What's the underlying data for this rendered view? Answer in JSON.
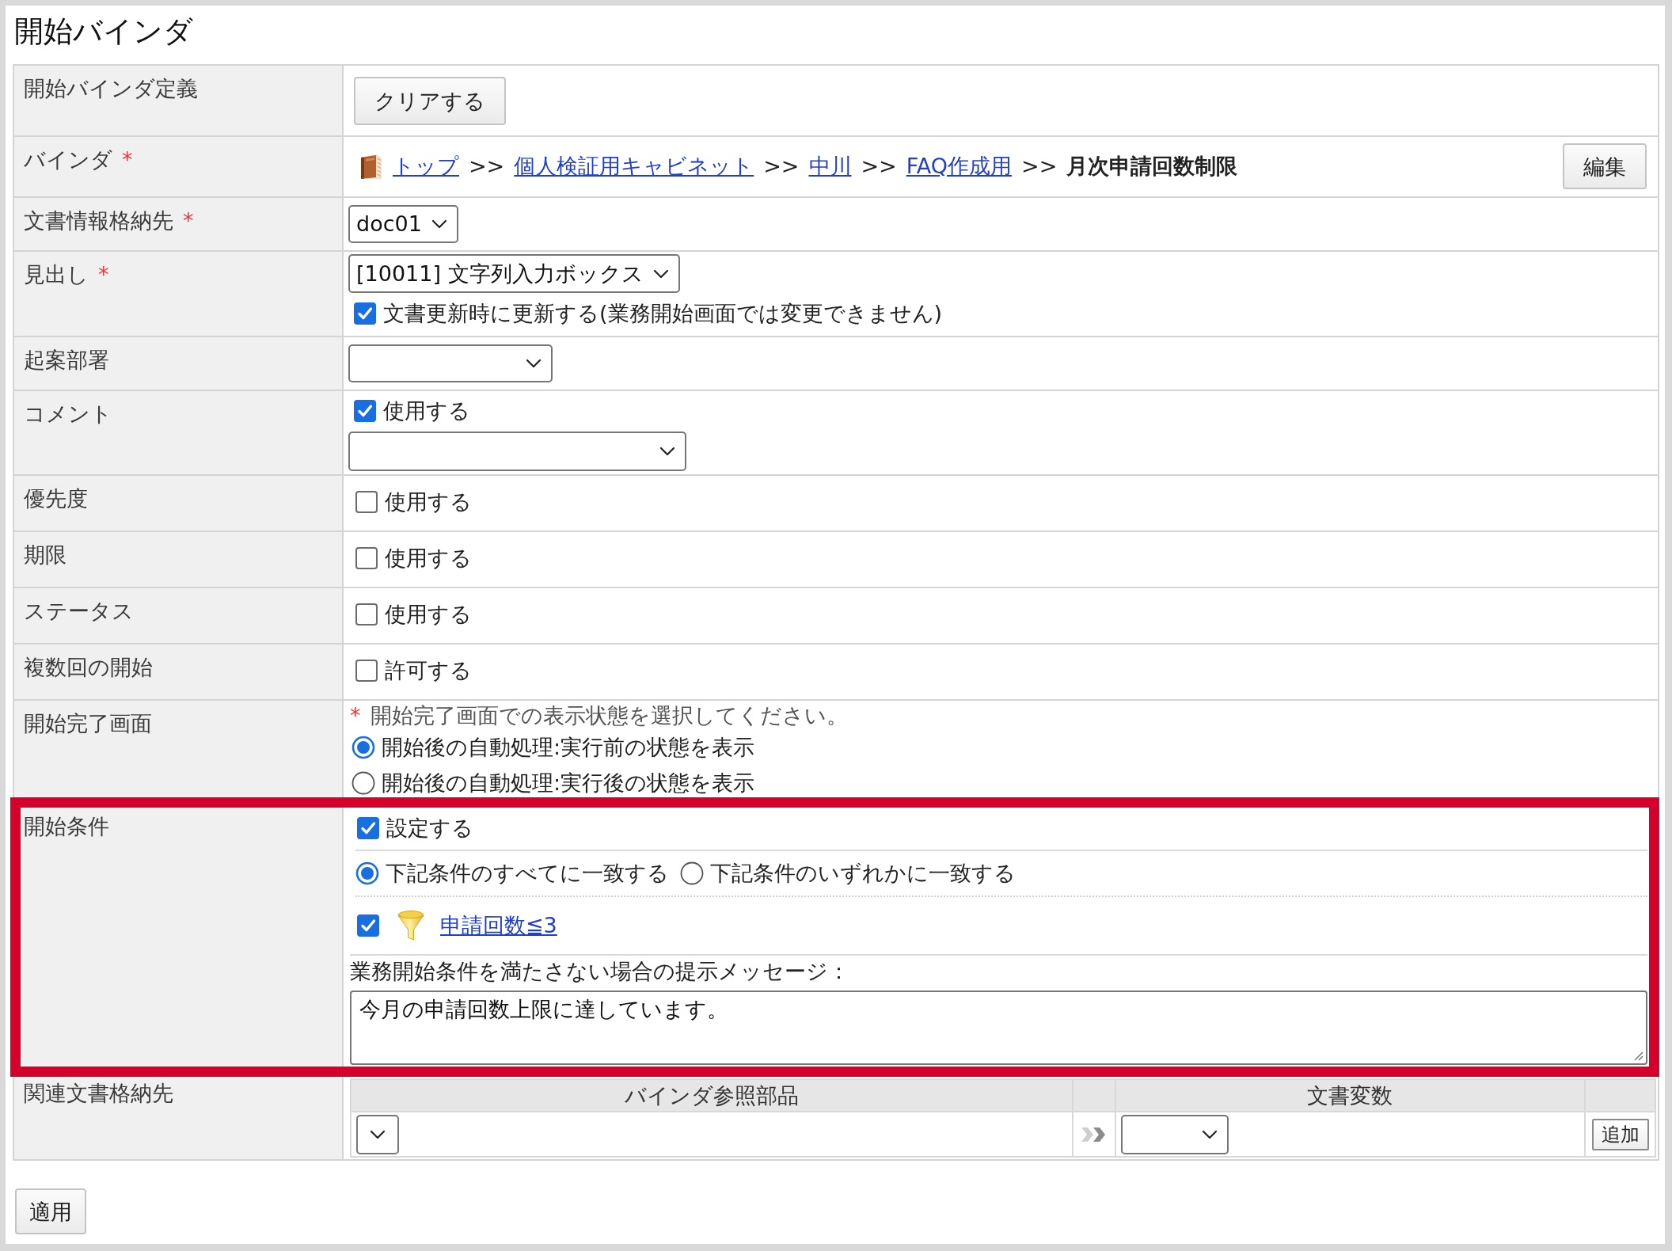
{
  "page": {
    "title": "開始バインダ"
  },
  "rows": [
    {
      "kind": "button",
      "label": "開始バインダ定義",
      "button": "クリアする"
    },
    {
      "kind": "breadcrumb",
      "label": "バインダ",
      "required_mark": "*",
      "path": [
        {
          "text": "トップ",
          "link": true
        },
        {
          "separator": ">>",
          "text": "個人検証用キャビネット",
          "link": true
        },
        {
          "separator": ">>",
          "text": "中川",
          "link": true
        },
        {
          "separator": ">>",
          "text": "FAQ作成用",
          "link": true
        },
        {
          "separator": ">>",
          "text": "月次申請回数制限",
          "link": false
        }
      ],
      "button": "編集"
    },
    {
      "kind": "select",
      "label": "文書情報格納先",
      "required_mark": "*",
      "select": {
        "value": "doc01"
      }
    },
    {
      "kind": "select_check",
      "label": "見出し",
      "required_mark": "*",
      "select": {
        "value": "[10011] 文字列入力ボックス"
      },
      "checkbox": {
        "label": "文書更新時に更新する(業務開始画面では変更できません)",
        "checked": true
      }
    },
    {
      "kind": "select",
      "label": "起案部署"
    },
    {
      "kind": "check_select",
      "label": "コメント",
      "checkbox": {
        "label": "使用する",
        "checked": true
      }
    },
    {
      "kind": "check",
      "label": "優先度",
      "checkbox": {
        "label": "使用する",
        "checked": false
      }
    },
    {
      "kind": "check",
      "label": "期限",
      "checkbox": {
        "label": "使用する",
        "checked": false
      }
    },
    {
      "kind": "check",
      "label": "ステータス",
      "checkbox": {
        "label": "使用する",
        "checked": false
      }
    },
    {
      "kind": "check",
      "label": "複数回の開始",
      "checkbox": {
        "label": "許可する",
        "checked": false
      }
    },
    {
      "kind": "radio_group",
      "label": "開始完了画面",
      "hint_mark": "*",
      "hint": "開始完了画面での表示状態を選択してください。",
      "options": [
        {
          "label": "開始後の自動処理:実行前の状態を表示",
          "selected": true
        },
        {
          "label": "開始後の自動処理:実行後の状態を表示",
          "selected": false
        }
      ]
    },
    {
      "kind": "condition",
      "label": "開始条件",
      "highlighted": true,
      "checkbox": {
        "label": "設定する",
        "checked": true
      },
      "match": [
        {
          "label": "下記条件のすべてに一致する",
          "selected": true
        },
        {
          "label": "下記条件のいずれかに一致する",
          "selected": false
        }
      ],
      "conditions": [
        {
          "checked": true,
          "text": "申請回数≦3"
        }
      ],
      "message_label": "業務開始条件を満たさない場合の提示メッセージ：",
      "message": "今月の申請回数上限に達しています。"
    },
    {
      "kind": "mapping",
      "label": "関連文書格納先",
      "columns": [
        "バインダ参照部品",
        "文書変数"
      ],
      "button": "追加"
    }
  ],
  "footer": {
    "button": "適用"
  }
}
